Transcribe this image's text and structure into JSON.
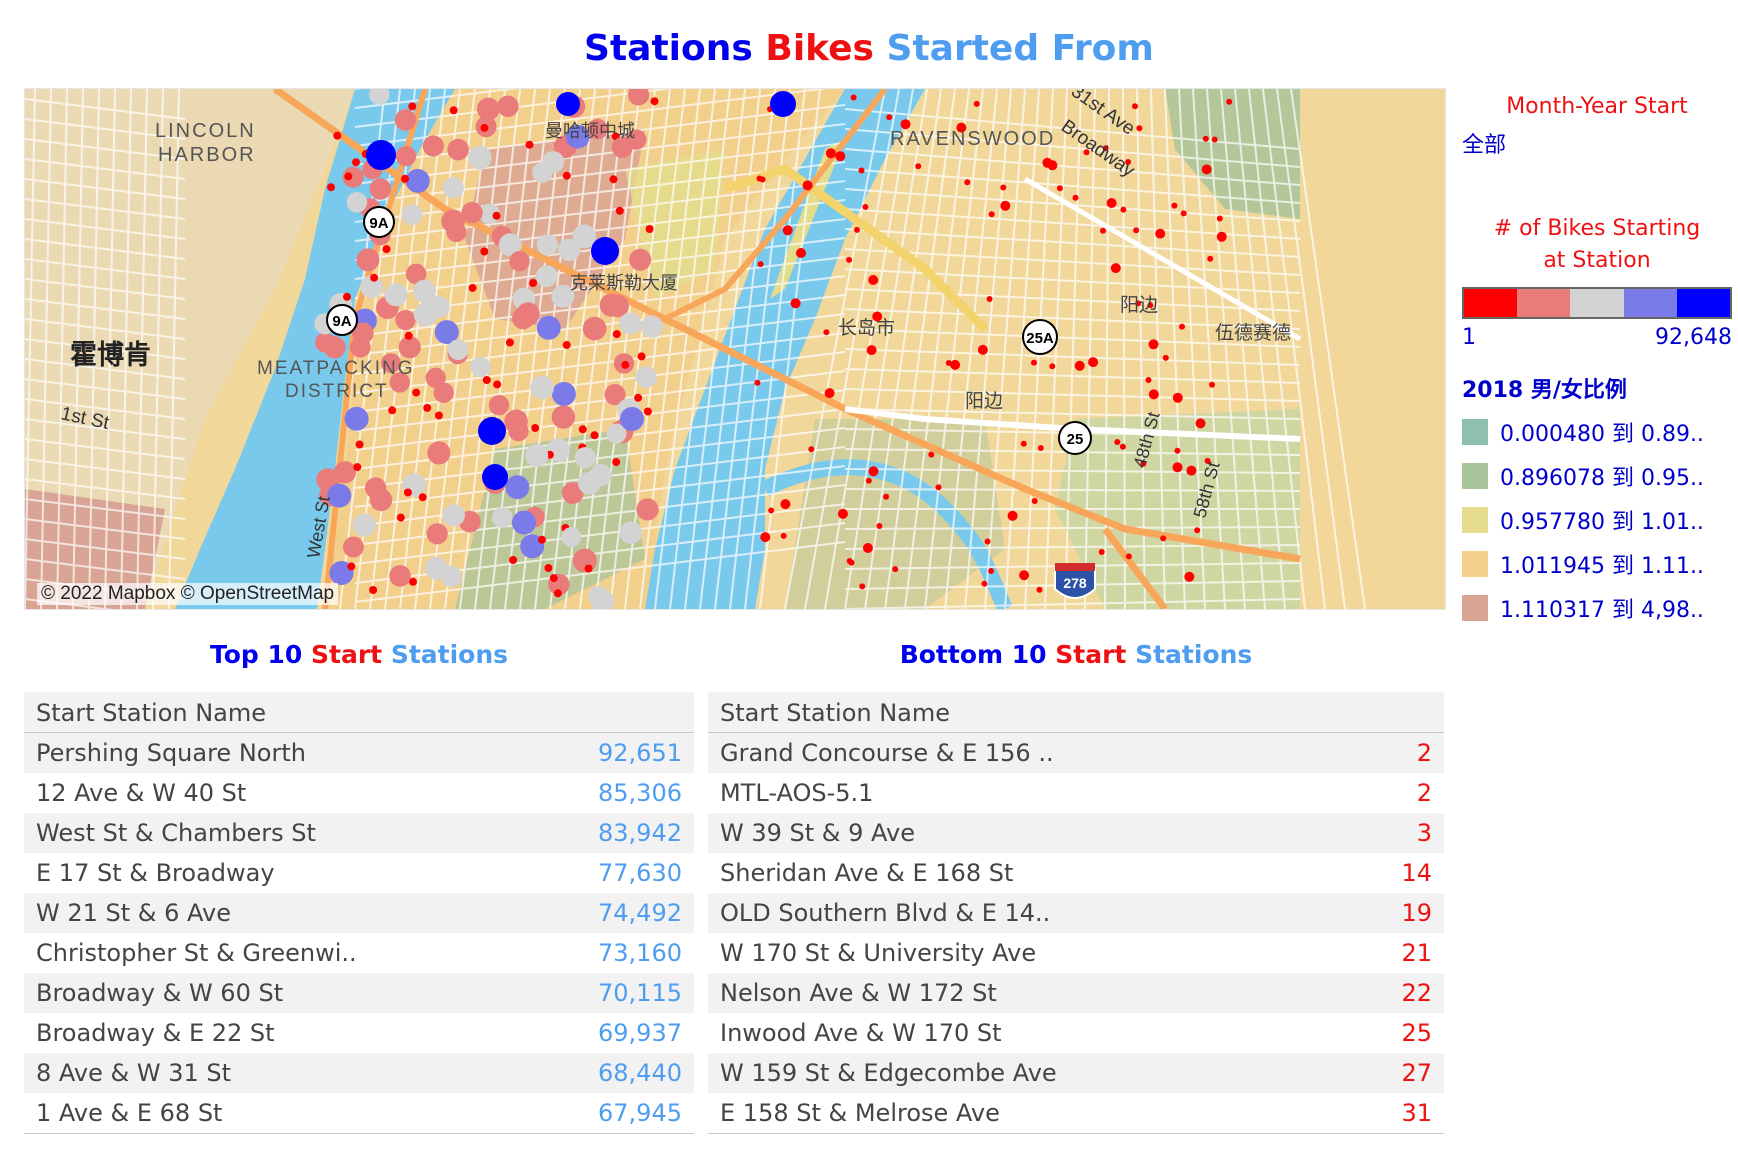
{
  "title": {
    "part1": "Stations",
    "part2": "Bikes",
    "part3": "Started From"
  },
  "map": {
    "attribution": "© 2022 Mapbox © OpenStreetMap",
    "labels": {
      "lincoln_harbor": [
        "LINCOLN",
        "HARBOR"
      ],
      "hoboken": "霍博肯",
      "meatpacking": [
        "MEATPACKING",
        "DISTRICT"
      ],
      "first_st": "1st St",
      "west_st": "West St",
      "ravenswood": "RAVENSWOOD",
      "broadway": "Broadway",
      "ave31": "31st Ave",
      "yangbian1": "阳边",
      "yangbian2": "阳边",
      "changdaoshi": "长岛市",
      "wudesai": "伍德赛德",
      "chrysler": "克莱斯勒大厦",
      "midtown": "曼哈顿中城",
      "ave48": "48th St",
      "ave58": "58th St",
      "route9a_1": "9A",
      "route9a_2": "9A",
      "route25a": "25A",
      "route25": "25",
      "i278": "278"
    },
    "colors": {
      "water": "#79c9ec",
      "land": "#f2d79b",
      "park": "#b9d6a6",
      "road": "#f7a65a"
    }
  },
  "filters": {
    "month_title": "Month-Year Start",
    "month_value": "全部"
  },
  "size_legend": {
    "title_line1": "# of Bikes Starting",
    "title_line2": "at Station",
    "min": "1",
    "max": "92,648",
    "colors": [
      "#ff0000",
      "#ea7b7b",
      "#d3d3d3",
      "#7a7ae8",
      "#0000ff"
    ]
  },
  "ratio_legend": {
    "title": "2018 男/女比例",
    "items": [
      {
        "label": "0.000480 到 0.89..",
        "color": "#8fbfb0"
      },
      {
        "label": "0.896078 到 0.95..",
        "color": "#a9c49b"
      },
      {
        "label": "0.957780 到 1.01..",
        "color": "#e2dc8c"
      },
      {
        "label": "1.011945 到 1.11..",
        "color": "#f3cf8c"
      },
      {
        "label": "1.110317 到 4,98..",
        "color": "#d9a493"
      }
    ]
  },
  "top_table": {
    "title": {
      "p1": "Top 10",
      "p2": "Start",
      "p3": "Stations"
    },
    "header": "Start Station Name",
    "rows": [
      {
        "name": "Pershing Square North",
        "value": "92,651"
      },
      {
        "name": "12 Ave & W 40 St",
        "value": "85,306"
      },
      {
        "name": "West St & Chambers St",
        "value": "83,942"
      },
      {
        "name": "E 17 St & Broadway",
        "value": "77,630"
      },
      {
        "name": "W 21 St & 6 Ave",
        "value": "74,492"
      },
      {
        "name": "Christopher St & Greenwi..",
        "value": "73,160"
      },
      {
        "name": "Broadway & W 60 St",
        "value": "70,115"
      },
      {
        "name": "Broadway & E 22 St",
        "value": "69,937"
      },
      {
        "name": "8 Ave & W 31 St",
        "value": "68,440"
      },
      {
        "name": "1 Ave & E 68 St",
        "value": "67,945"
      }
    ]
  },
  "bottom_table": {
    "title": {
      "p1": "Bottom 10",
      "p2": "Start",
      "p3": "Stations"
    },
    "header": "Start Station Name",
    "rows": [
      {
        "name": "Grand Concourse & E 156 ..",
        "value": "2"
      },
      {
        "name": "MTL-AOS-5.1",
        "value": "2"
      },
      {
        "name": "W 39 St & 9 Ave",
        "value": "3"
      },
      {
        "name": "Sheridan Ave & E 168 St",
        "value": "14"
      },
      {
        "name": "OLD Southern Blvd & E 14..",
        "value": "19"
      },
      {
        "name": "W 170 St & University Ave",
        "value": "21"
      },
      {
        "name": "Nelson Ave & W 172 St",
        "value": "22"
      },
      {
        "name": "Inwood Ave & W 170 St",
        "value": "25"
      },
      {
        "name": "W 159 St & Edgecombe Ave",
        "value": "27"
      },
      {
        "name": "E 158 St & Melrose Ave",
        "value": "31"
      }
    ]
  }
}
